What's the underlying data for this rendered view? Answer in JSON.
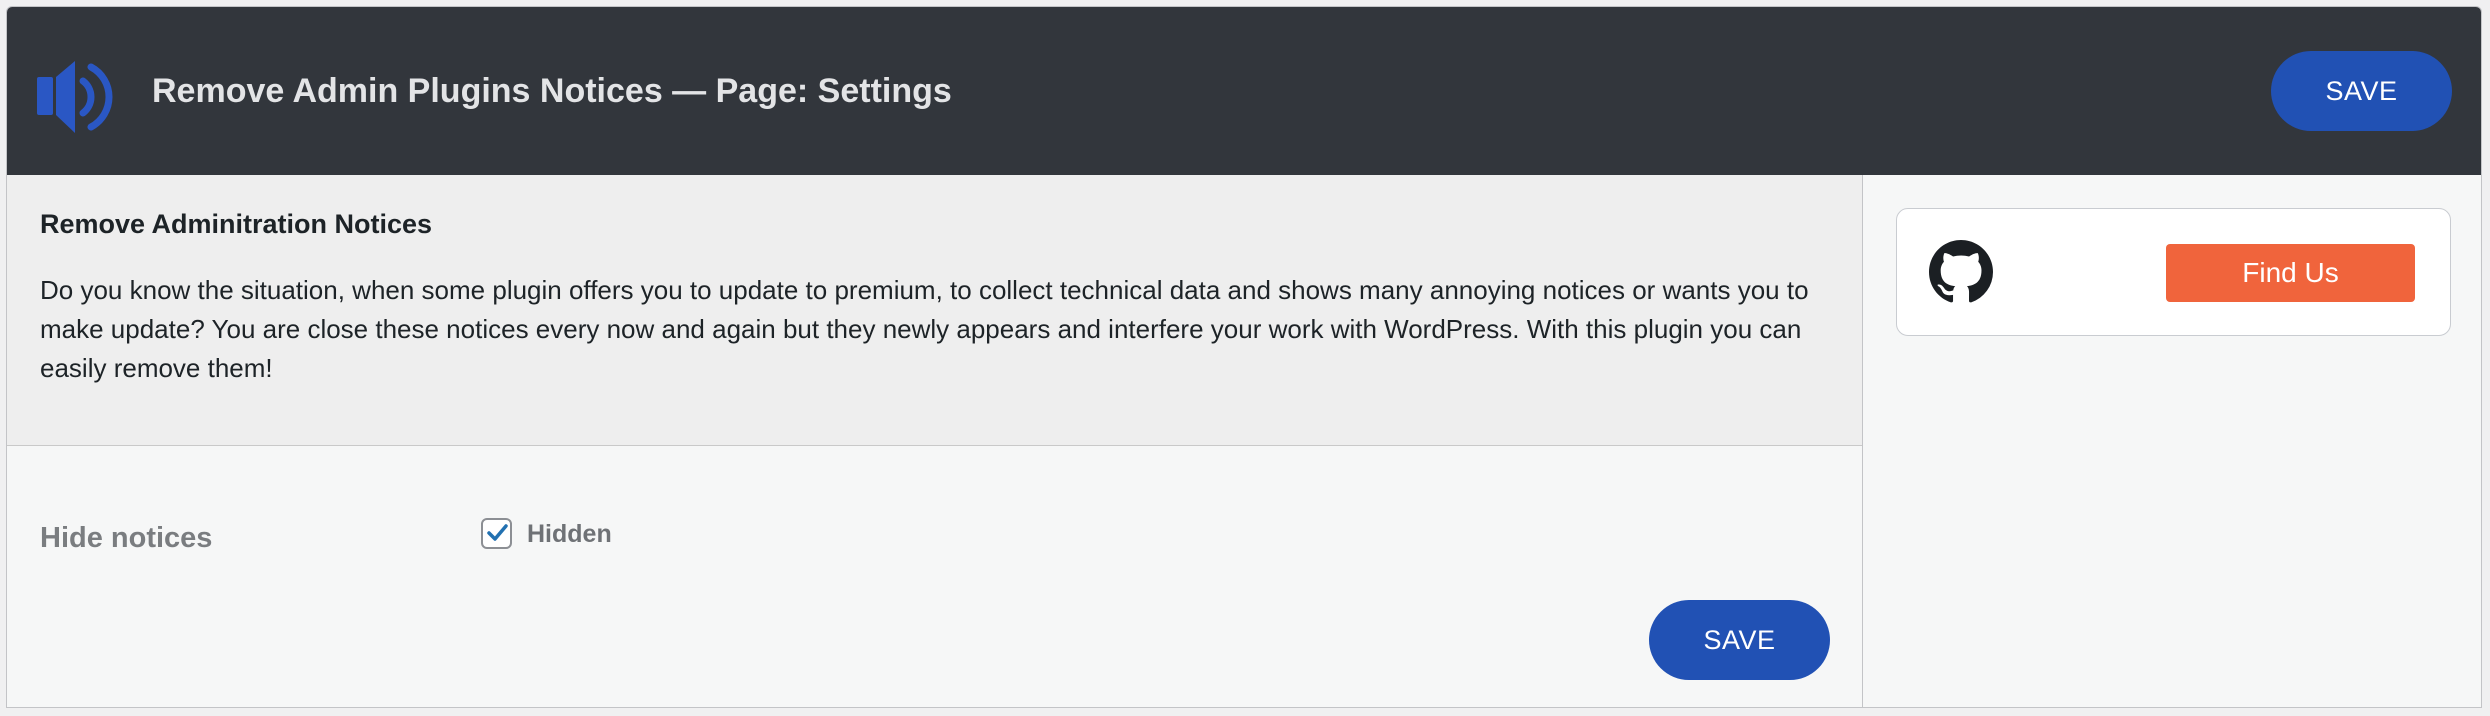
{
  "header": {
    "title": "Remove Admin Plugins Notices — Page: Settings",
    "save_label": "SAVE",
    "logo_icon": "speaker-icon"
  },
  "intro": {
    "title": "Remove Adminitration Notices",
    "text": "Do you know the situation, when some plugin offers you to update to premium, to collect technical data and shows many annoying notices or wants you to make update? You are close these notices every now and again but they newly appears and interfere your work with WordPress. With this plugin you can easily remove them!"
  },
  "settings": {
    "hide_notices_label": "Hide notices",
    "hidden_checkbox_label": "Hidden",
    "hidden_checked": true,
    "save_label": "SAVE"
  },
  "sidebar": {
    "github_icon": "github-icon",
    "find_us_label": "Find Us"
  },
  "colors": {
    "header_bg": "#32363c",
    "save_button": "#2151b4",
    "find_us_button": "#f0643c"
  }
}
